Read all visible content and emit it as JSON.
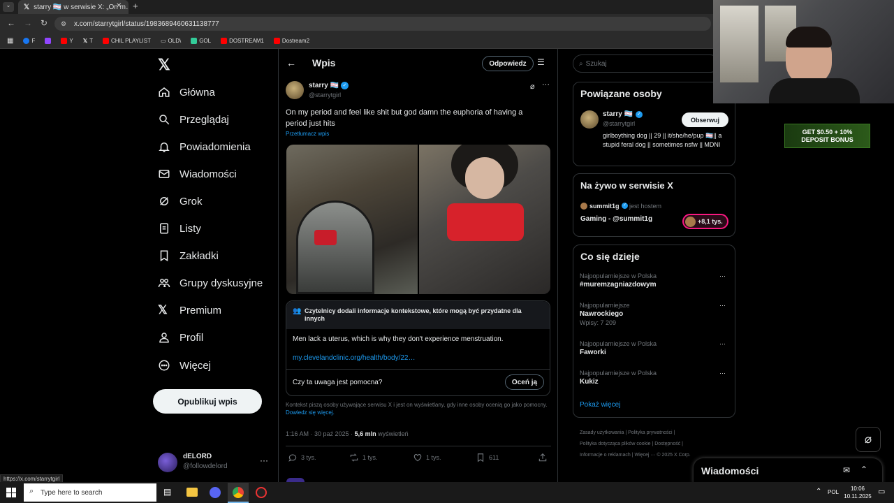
{
  "browser": {
    "tab_title": "starry 🏳️‍⚧️ w serwisie X: „On m…",
    "url": "x.com/starrytgirl/status/1983689460631138777",
    "status_url": "https://x.com/starrytgirl",
    "bookmarks": [
      "F",
      "Y",
      "T",
      "CHIL PLAYLIST",
      "OLD\\",
      "GOL",
      "DOSTREAM1",
      "Dostream2"
    ]
  },
  "sidebar": {
    "items": [
      {
        "label": "Główna",
        "icon": "home-icon"
      },
      {
        "label": "Przeglądaj",
        "icon": "search-icon"
      },
      {
        "label": "Powiadomienia",
        "icon": "bell-icon"
      },
      {
        "label": "Wiadomości",
        "icon": "mail-icon"
      },
      {
        "label": "Grok",
        "icon": "grok-icon"
      },
      {
        "label": "Listy",
        "icon": "list-icon"
      },
      {
        "label": "Zakładki",
        "icon": "bookmark-icon"
      },
      {
        "label": "Grupy dyskusyjne",
        "icon": "people-icon"
      },
      {
        "label": "Premium",
        "icon": "x-logo-icon"
      },
      {
        "label": "Profil",
        "icon": "person-icon"
      },
      {
        "label": "Więcej",
        "icon": "more-circle-icon"
      }
    ],
    "post_button": "Opublikuj wpis",
    "account": {
      "name": "dELORD",
      "handle": "@followdelord"
    }
  },
  "main": {
    "header_title": "Wpis",
    "reply_button": "Odpowiedz",
    "post": {
      "author": "starry 🏳️‍⚧️",
      "handle": "@starrytgirl",
      "text": "On my period and feel like shit but god damn the euphoria of having a period just hits",
      "translate": "Przetłumacz wpis",
      "note_header": "Czytelnicy dodali informacje kontekstowe, które mogą być przydatne dla innych",
      "note_text": "Men lack a uterus, which is why they don't experience menstruation.",
      "note_link": "my.clevelandclinic.org/health/body/22…",
      "note_question": "Czy ta uwaga jest pomocna?",
      "rate_button": "Oceń ją",
      "note_footer": "Kontekst piszą osoby używające serwisu X i jest on wyświetlany, gdy inne osoby ocenią go jako pomocny.",
      "note_footer_link": "Dowiedz się więcej.",
      "time": "1:16 AM · 30 paź 2025 ·",
      "views": "5,6 mln",
      "views_label": "wyświetleń",
      "stats": {
        "replies": "3 tys.",
        "reposts": "1 tys.",
        "likes": "1 tys.",
        "bookmarks": "611"
      }
    }
  },
  "right": {
    "search_placeholder": "Szukaj",
    "related_title": "Powiązane osoby",
    "related": {
      "name": "starry 🏳️‍⚧️",
      "handle": "@starrytgirl",
      "follow": "Obserwuj",
      "bio": "girlboything dog || 29 || it/she/he/pup 🏳️‍⚧️|| a stupid feral dog || sometimes nsfw || MDNI"
    },
    "live_title": "Na żywo w serwisie X",
    "live": {
      "host": "summit1g",
      "host_suffix": "jest hostem",
      "title": "Gaming - @summit1g",
      "count": "+8,1 tys."
    },
    "trends_title": "Co się dzieje",
    "trends": [
      {
        "meta": "Najpopularniejsze w Polska",
        "name": "#muremzagniazdowym",
        "count": ""
      },
      {
        "meta": "Najpopularniejsze",
        "name": "Nawrockiego",
        "count": "Wpisy: 7 209"
      },
      {
        "meta": "Najpopularniejsze w Polska",
        "name": "Faworki",
        "count": ""
      },
      {
        "meta": "Najpopularniejsze w Polska",
        "name": "Kukiz",
        "count": ""
      }
    ],
    "show_more": "Pokaż więcej",
    "footer1": "Zasady użytkowania  |  Polityka prywatności  |",
    "footer2": "Polityka dotycząca plików cookie  |  Dostępność  |",
    "footer3": "Informacje o reklamach  |  Więcej ···  © 2025 X Corp.",
    "ad_text1": "GET $0.50 + 10%",
    "ad_text2": "DEPOSIT BONUS",
    "messages": "Wiadomości"
  },
  "taskbar": {
    "search_placeholder": "Type here to search",
    "lang": "POL",
    "time": "10:06",
    "date": "10.11.2025"
  }
}
